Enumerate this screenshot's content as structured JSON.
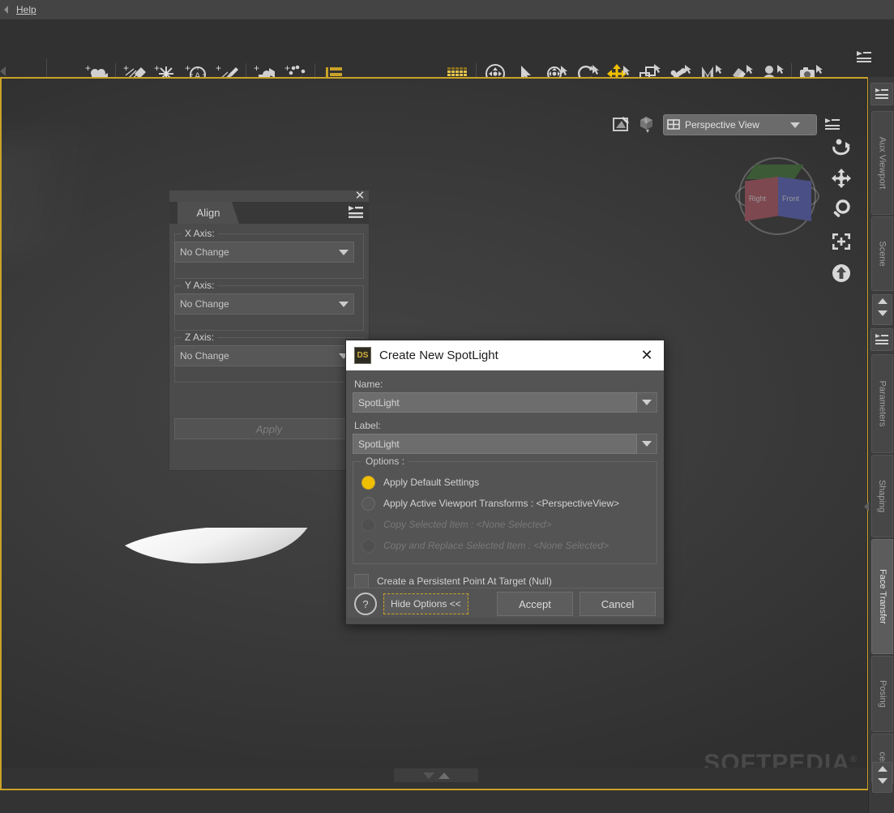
{
  "menubar": {
    "items": [
      {
        "label": "Help",
        "accel": "H"
      }
    ]
  },
  "toolbar": {
    "left_group": [
      {
        "name": "create-camera-icon",
        "tooltip": "Create New Camera"
      },
      {
        "name": "create-distant-light-icon",
        "tooltip": "Create New Distant Light"
      },
      {
        "name": "create-point-light-icon",
        "tooltip": "Create New Point Light"
      },
      {
        "name": "create-linear-light-icon",
        "tooltip": "Create New Linear Point Light"
      },
      {
        "name": "create-spotlight-icon",
        "tooltip": "Create New SpotLight"
      },
      {
        "name": "create-null-icon",
        "tooltip": "Create New Null"
      },
      {
        "name": "create-group-icon",
        "tooltip": "Create New Group"
      },
      {
        "name": "layers-list-icon",
        "tooltip": "Layered Image Editor"
      }
    ],
    "right_group": [
      {
        "name": "render-grid-icon",
        "tooltip": "Render"
      },
      {
        "name": "universal-manipulator-icon",
        "tooltip": "Universal Manipulator"
      },
      {
        "name": "node-selection-icon",
        "tooltip": "Node Selection"
      },
      {
        "name": "rotate-tool-icon",
        "tooltip": "Rotate"
      },
      {
        "name": "rotate-alt-tool-icon",
        "tooltip": "Rotate Alternate"
      },
      {
        "name": "translate-tool-icon",
        "tooltip": "Translate",
        "active": true
      },
      {
        "name": "scale-tool-icon",
        "tooltip": "Scale"
      },
      {
        "name": "bone-tool-icon",
        "tooltip": "Joint Editor"
      },
      {
        "name": "morph-tool-icon",
        "tooltip": "Morph"
      },
      {
        "name": "surface-tool-icon",
        "tooltip": "Surface Selection"
      },
      {
        "name": "node-figure-icon",
        "tooltip": "Figure Setup"
      },
      {
        "name": "camera-tool-icon",
        "tooltip": "Camera"
      }
    ],
    "menu_icon": "toolbar-menu-icon"
  },
  "viewport": {
    "draw_style_icon": "draw-style-icon",
    "camera_cube_icon": "camera-view-icon",
    "view_selector": {
      "value": "Perspective View",
      "grid_icon": "grid-icon"
    },
    "menu_icon": "viewport-menu-icon",
    "cube": {
      "left_face": "Right",
      "right_face": "Front"
    },
    "nav": [
      {
        "name": "orbit-icon",
        "tooltip": "Orbit Camera"
      },
      {
        "name": "pan-icon",
        "tooltip": "Pan Camera"
      },
      {
        "name": "zoom-icon",
        "tooltip": "Zoom Camera"
      },
      {
        "name": "frame-icon",
        "tooltip": "Frame Selection"
      },
      {
        "name": "reset-view-icon",
        "tooltip": "Reset Camera"
      }
    ],
    "watermark": "SOFTPEDIA",
    "watermark_mark": "®"
  },
  "right_dock": {
    "tabs": [
      {
        "label": "Aux Viewport",
        "active": false
      },
      {
        "label": "Scene",
        "active": false
      },
      {
        "label": "Parameters",
        "active": false
      },
      {
        "label": "Shaping",
        "active": false
      },
      {
        "label": "Face Transfer",
        "active": true
      },
      {
        "label": "Posing",
        "active": false
      },
      {
        "label": "ces",
        "active": false
      }
    ],
    "top_menu_icon": "dock-menu-icon",
    "mid_menu_icon": "dock-menu-icon-2",
    "scroll_up_icon": "scroll-up-icon",
    "scroll_down_icon": "scroll-down-icon"
  },
  "align_panel": {
    "tab_label": "Align",
    "close_icon": "close-icon",
    "menu_icon": "panel-menu-icon",
    "groups": [
      {
        "label": "X Axis:",
        "value": "No Change"
      },
      {
        "label": "Y Axis:",
        "value": "No Change"
      },
      {
        "label": "Z Axis:",
        "value": "No Change"
      }
    ],
    "apply_label": "Apply"
  },
  "dialog": {
    "icon_text": "DS",
    "title": "Create New SpotLight",
    "close_icon": "close-icon",
    "name_label": "Name:",
    "name_value": "SpotLight",
    "label_label": "Label:",
    "label_value": "SpotLight",
    "options_label": "Options :",
    "options": [
      {
        "label": "Apply Default Settings",
        "selected": true,
        "disabled": false
      },
      {
        "label": "Apply Active Viewport Transforms : <PerspectiveView>",
        "selected": false,
        "disabled": false
      },
      {
        "label": "Copy Selected Item : <None Selected>",
        "selected": false,
        "disabled": true
      },
      {
        "label": "Copy and Replace Selected Item : <None Selected>",
        "selected": false,
        "disabled": true
      }
    ],
    "checkbox": {
      "label": "Create a Persistent Point At Target (Null)",
      "checked": false
    },
    "help_icon": "help-icon",
    "hide_options_label": "Hide Options <<",
    "accept_label": "Accept",
    "cancel_label": "Cancel"
  },
  "colors": {
    "accent_gold": "#c9a227",
    "radio_on": "#f0c000",
    "dialog_bg": "#545454",
    "viewport_bg": "#3a3a3a"
  }
}
